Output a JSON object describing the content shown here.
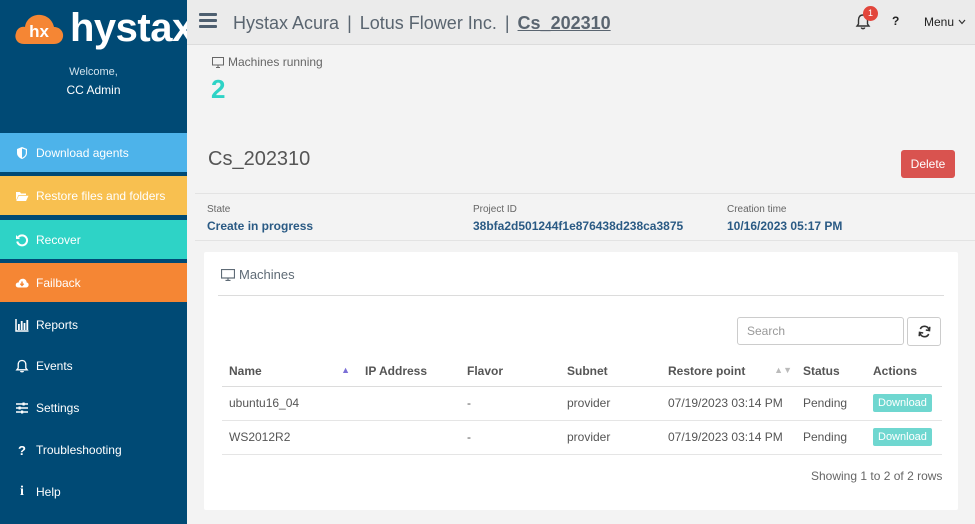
{
  "app": {
    "logo_badge": "hx",
    "logo_word": "hystax",
    "welcome": "Welcome,",
    "user": "CC Admin"
  },
  "sidebar": {
    "items": [
      {
        "label": "Download agents",
        "icon": "shield-icon",
        "color": "#4db3ea"
      },
      {
        "label": "Restore files and folders",
        "icon": "folder-open-icon",
        "color": "#f8c050"
      },
      {
        "label": "Recover",
        "icon": "undo-icon",
        "color": "#2ed3c6"
      },
      {
        "label": "Failback",
        "icon": "cloud-download-icon",
        "color": "#f58634"
      },
      {
        "label": "Reports",
        "icon": "bar-chart-icon"
      },
      {
        "label": "Events",
        "icon": "bell-icon"
      },
      {
        "label": "Settings",
        "icon": "sliders-icon"
      },
      {
        "label": "Troubleshooting",
        "icon": "question-icon"
      },
      {
        "label": "Help",
        "icon": "info-icon"
      }
    ]
  },
  "header": {
    "crumb1": "Hystax Acura",
    "crumb2": "Lotus Flower Inc.",
    "crumb3": "Cs_202310",
    "separator": "|",
    "notification_count": "1",
    "help_label": "?",
    "menu_label": "Menu"
  },
  "machines_running": {
    "label": "Machines running",
    "value": "2"
  },
  "project": {
    "title": "Cs_202310",
    "delete_label": "Delete",
    "state_label": "State",
    "state_value": "Create in progress",
    "id_label": "Project ID",
    "id_value": "38bfa2d501244f1e876438d238ca3875",
    "created_label": "Creation time",
    "created_value": "10/16/2023 05:17 PM"
  },
  "machines": {
    "title": "Machines",
    "search_placeholder": "Search",
    "columns": [
      "Name",
      "IP Address",
      "Flavor",
      "Subnet",
      "Restore point",
      "Status",
      "Actions"
    ],
    "rows": [
      {
        "name": "ubuntu16_04",
        "ip": "",
        "flavor": "-",
        "subnet": "provider",
        "restore_point": "07/19/2023 03:14 PM",
        "status": "Pending",
        "action": "Download"
      },
      {
        "name": "WS2012R2",
        "ip": "",
        "flavor": "-",
        "subnet": "provider",
        "restore_point": "07/19/2023 03:14 PM",
        "status": "Pending",
        "action": "Download"
      }
    ],
    "footer": "Showing 1 to 2 of 2 rows"
  },
  "colors": {
    "sidebar_bg": "#004a75",
    "accent_teal": "#2ed3c6",
    "danger": "#d9534f",
    "logo_orange": "#f58634"
  }
}
